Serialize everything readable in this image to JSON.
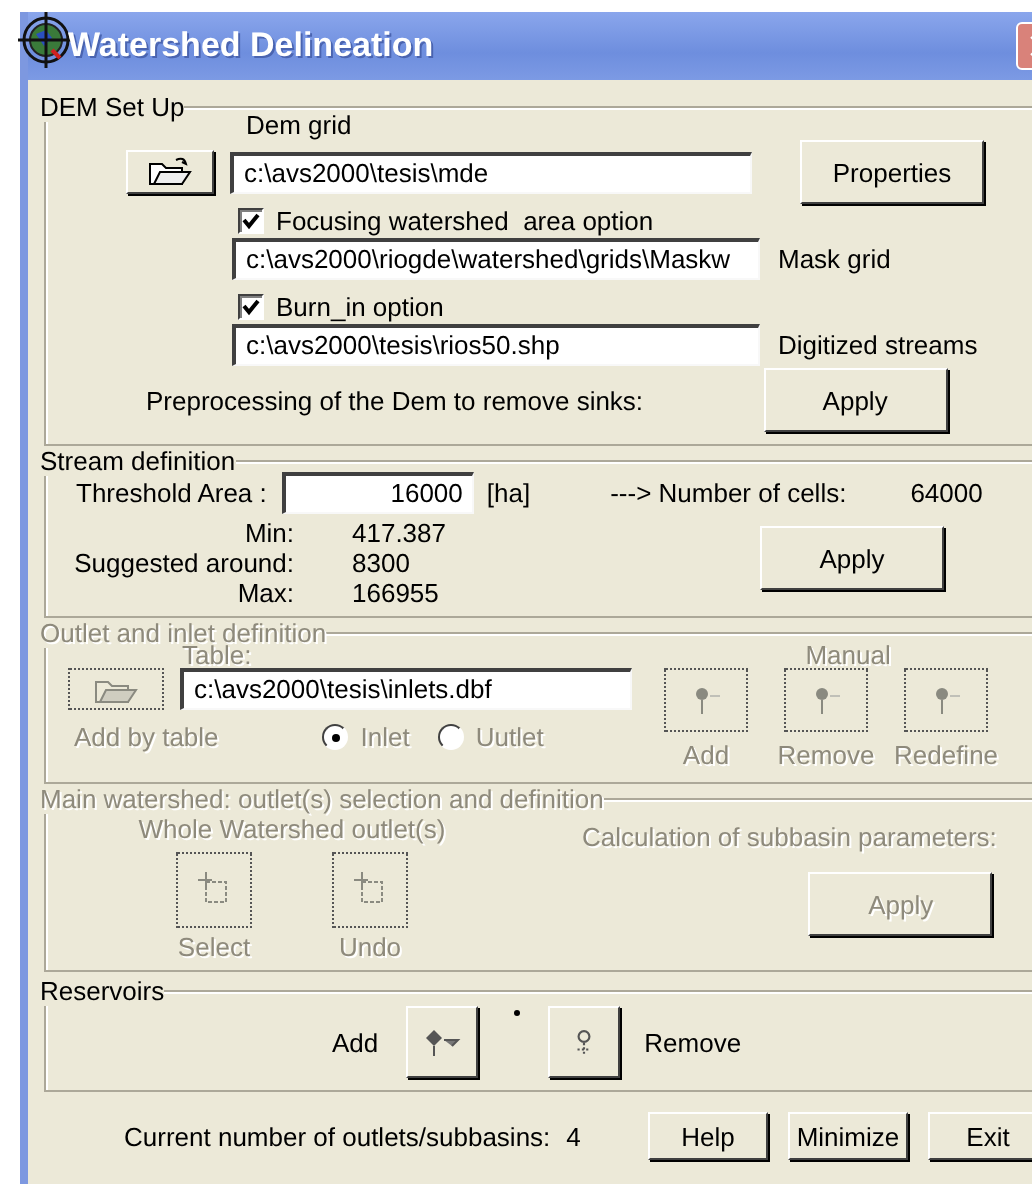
{
  "window": {
    "title": "Watershed Delineation"
  },
  "dem_setup": {
    "title": "DEM Set Up",
    "dem_grid_label": "Dem grid",
    "dem_grid_value": "c:\\avs2000\\tesis\\mde",
    "properties_button": "Properties",
    "focusing": {
      "label": "Focusing watershed  area option",
      "checked": true
    },
    "mask_value": "c:\\avs2000\\riogde\\watershed\\grids\\Maskw",
    "mask_label": "Mask grid",
    "burn_in": {
      "label": "Burn_in option",
      "checked": true
    },
    "streams_value": "c:\\avs2000\\tesis\\rios50.shp",
    "streams_label": "Digitized streams",
    "preprocess_label": "Preprocessing of the Dem to remove sinks:",
    "apply_button": "Apply"
  },
  "stream_definition": {
    "title": "Stream definition",
    "threshold_label": "Threshold Area :",
    "threshold_value": "16000",
    "unit": "[ha]",
    "cells_label": "---> Number of cells:",
    "cells_value": "64000",
    "stats": [
      {
        "label": "Min:",
        "value": "417.387"
      },
      {
        "label": "Suggested around:",
        "value": "8300"
      },
      {
        "label": "Max:",
        "value": "166955"
      }
    ],
    "apply_button": "Apply"
  },
  "outlet_inlet": {
    "title": "Outlet  and inlet definition",
    "disabled": true,
    "table_label": "Table:",
    "table_value": "c:\\avs2000\\tesis\\inlets.dbf",
    "add_by_table": "Add by table",
    "types": [
      {
        "label": "Inlet",
        "selected": true
      },
      {
        "label": "Uutlet",
        "selected": false
      }
    ],
    "manual_label": "Manual",
    "manual_buttons": [
      "Add",
      "Remove",
      "Redefine"
    ]
  },
  "main_watershed": {
    "title": "Main watershed: outlet(s) selection and definition",
    "disabled": true,
    "whole_label": "Whole Watershed outlet(s)",
    "buttons": [
      "Select",
      "Undo"
    ],
    "calc_label": "Calculation of subbasin parameters:",
    "apply_button": "Apply"
  },
  "reservoirs": {
    "title": "Reservoirs",
    "add_label": "Add",
    "remove_label": "Remove"
  },
  "footer": {
    "count_label": "Current number of outlets/subbasins:",
    "count": "4",
    "buttons": [
      "Help",
      "Minimize",
      "Exit"
    ]
  }
}
